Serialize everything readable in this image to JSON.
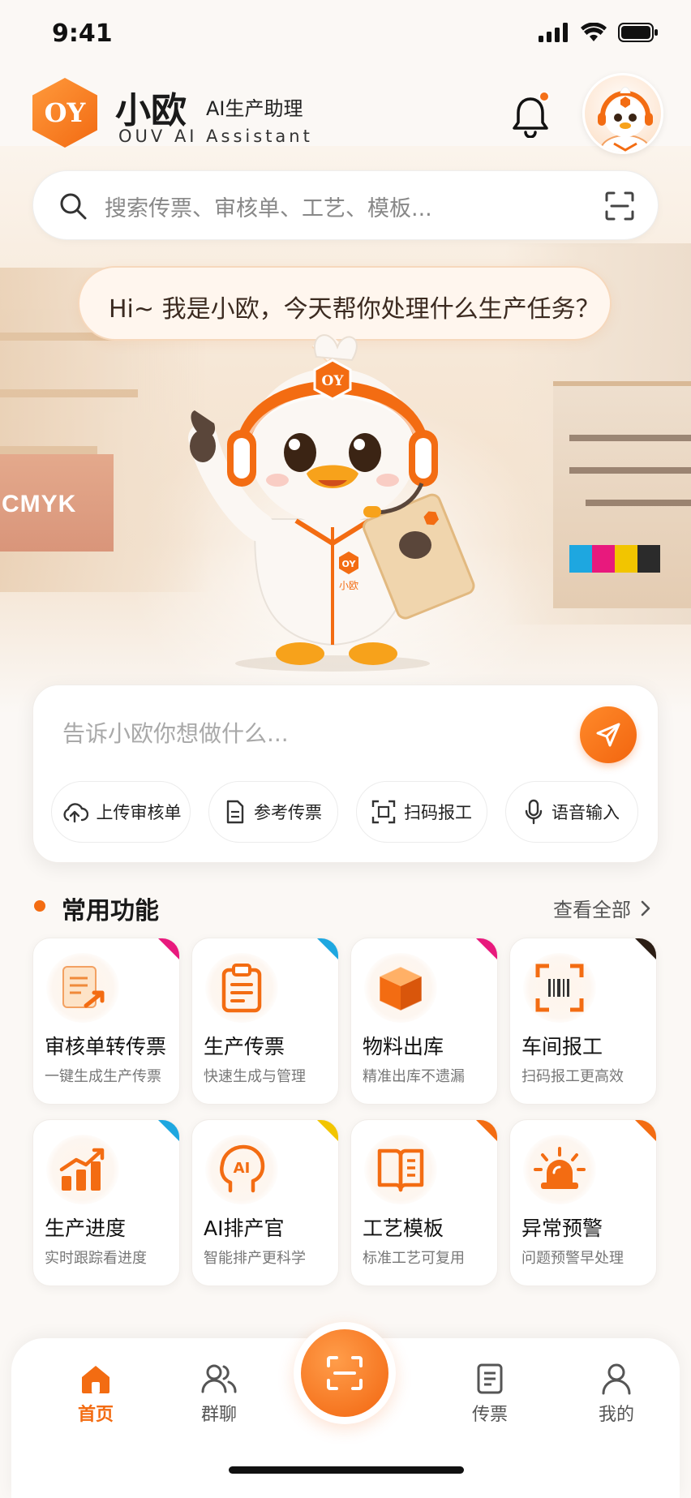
{
  "status_bar": {
    "time": "9:41"
  },
  "header": {
    "logo_text": "OY",
    "app_name": "小欧",
    "app_tag": "AI生产助理",
    "app_subtitle": "OUV AI Assistant",
    "has_notification": true
  },
  "search": {
    "placeholder": "搜索传票、审核单、工艺、模板..."
  },
  "hero": {
    "greeting": "Hi~ 我是小欧，今天帮你处理什么生产任务？",
    "mascot_badge": "OY",
    "mascot_chest": "小欧",
    "background_sign": "CMYK"
  },
  "chat": {
    "placeholder": "告诉小欧你想做什么...",
    "quick_actions": [
      {
        "label": "上传审核单",
        "icon": "cloud-upload-icon"
      },
      {
        "label": "参考传票",
        "icon": "document-icon"
      },
      {
        "label": "扫码报工",
        "icon": "scan-icon"
      },
      {
        "label": "语音输入",
        "icon": "microphone-icon"
      }
    ]
  },
  "features": {
    "title": "常用功能",
    "more_label": "查看全部",
    "items": [
      {
        "title": "审核单转传票",
        "desc": "一键生成生产传票",
        "icon": "review-to-ticket-icon",
        "corner": "#e8197d"
      },
      {
        "title": "生产传票",
        "desc": "快速生成与管理",
        "icon": "clipboard-icon",
        "corner": "#1ea7e0"
      },
      {
        "title": "物料出库",
        "desc": "精准出库不遗漏",
        "icon": "box-icon",
        "corner": "#e8197d"
      },
      {
        "title": "车间报工",
        "desc": "扫码报工更高效",
        "icon": "barcode-scan-icon",
        "corner": "#2b1d14"
      },
      {
        "title": "生产进度",
        "desc": "实时跟踪看进度",
        "icon": "bar-chart-icon",
        "corner": "#1ea7e0"
      },
      {
        "title": "AI排产官",
        "desc": "智能排产更科学",
        "icon": "ai-head-icon",
        "corner": "#f2c500"
      },
      {
        "title": "工艺模板",
        "desc": "标准工艺可复用",
        "icon": "book-icon",
        "corner": "#f36c12"
      },
      {
        "title": "异常预警",
        "desc": "问题预警早处理",
        "icon": "alarm-light-icon",
        "corner": "#f36c12"
      }
    ]
  },
  "nav": {
    "items": [
      {
        "label": "首页",
        "icon": "home-icon",
        "active": true
      },
      {
        "label": "群聊",
        "icon": "group-icon",
        "active": false
      },
      {
        "label": "传票",
        "icon": "ticket-icon",
        "active": false
      },
      {
        "label": "我的",
        "icon": "user-icon",
        "active": false
      }
    ],
    "center_icon": "scan-icon"
  },
  "colors": {
    "accent": "#f36c12",
    "accent_light": "#ff9a3c"
  }
}
